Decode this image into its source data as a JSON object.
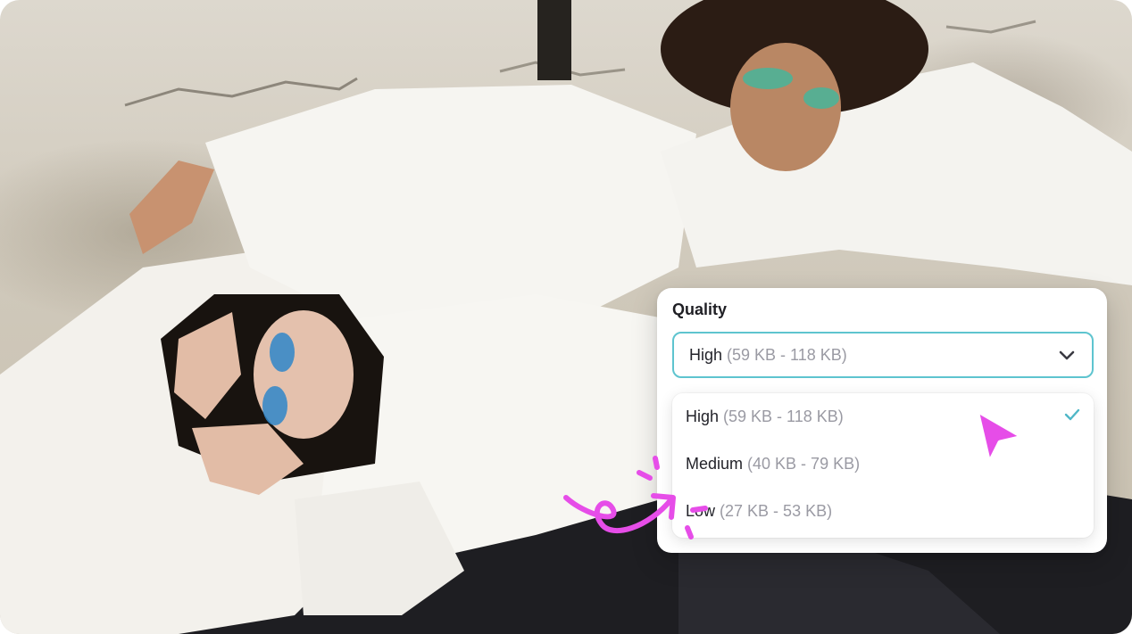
{
  "quality_menu": {
    "label": "Quality",
    "selected": {
      "name": "High",
      "size": "(59 KB - 118 KB)"
    },
    "options": [
      {
        "name": "High",
        "size": "(59 KB - 118 KB)",
        "selected": true
      },
      {
        "name": "Medium",
        "size": "(40 KB - 79 KB)",
        "selected": false
      },
      {
        "name": "Low",
        "size": "(27 KB - 53 KB)",
        "selected": false
      }
    ]
  },
  "icons": {
    "select_arrow": "chevron-down-icon",
    "selected_mark": "checkmark-icon",
    "pointer": "pointer-cursor-icon",
    "annotation": "squiggle-arrow-icon"
  },
  "colors": {
    "accent_border": "#5ec4cf",
    "check": "#4fb7c7",
    "annotation": "#e64de8",
    "muted_text": "#9a9aa3"
  }
}
